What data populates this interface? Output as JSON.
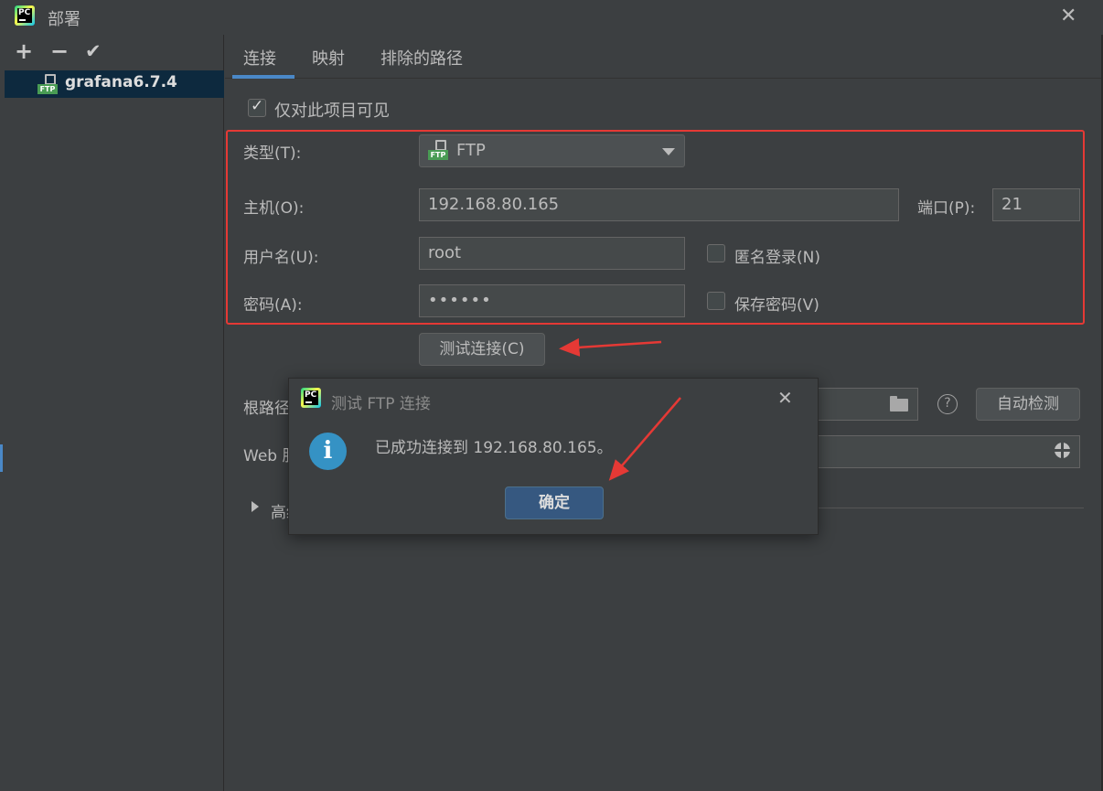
{
  "window": {
    "title": "部署"
  },
  "sidebar": {
    "tools": {
      "add": "+",
      "remove": "−",
      "apply": "✔"
    },
    "items": [
      {
        "label": "grafana6.7.4",
        "type": "FTP"
      }
    ]
  },
  "tabs": [
    {
      "label": "连接"
    },
    {
      "label": "映射"
    },
    {
      "label": "排除的路径"
    }
  ],
  "connection": {
    "visible_only_label": "仅对此项目可见",
    "visible_only_checked": true,
    "type_label": "类型(T):",
    "type_value": "FTP",
    "host_label": "主机(O):",
    "host_value": "192.168.80.165",
    "port_label": "端口(P):",
    "port_value": "21",
    "username_label": "用户名(U):",
    "username_value": "root",
    "anonymous_label": "匿名登录(N)",
    "anonymous_checked": false,
    "password_label": "密码(A):",
    "password_value": "••••••",
    "save_password_label": "保存密码(V)",
    "save_password_checked": false,
    "test_button": "测试连接(C)",
    "root_path_label": "根路径",
    "auto_detect_button": "自动检测",
    "web_url_label": "Web 服",
    "advanced_label": "高级",
    "help_icon_glyph": "?"
  },
  "dialog": {
    "title": "测试 FTP 连接",
    "message": "已成功连接到 192.168.80.165。",
    "ok_button": "确定",
    "info_glyph": "i"
  },
  "colors": {
    "background": "#3c3f41",
    "accent": "#4a88c7",
    "annotation_red": "#e53935",
    "info_blue": "#3592c4"
  }
}
